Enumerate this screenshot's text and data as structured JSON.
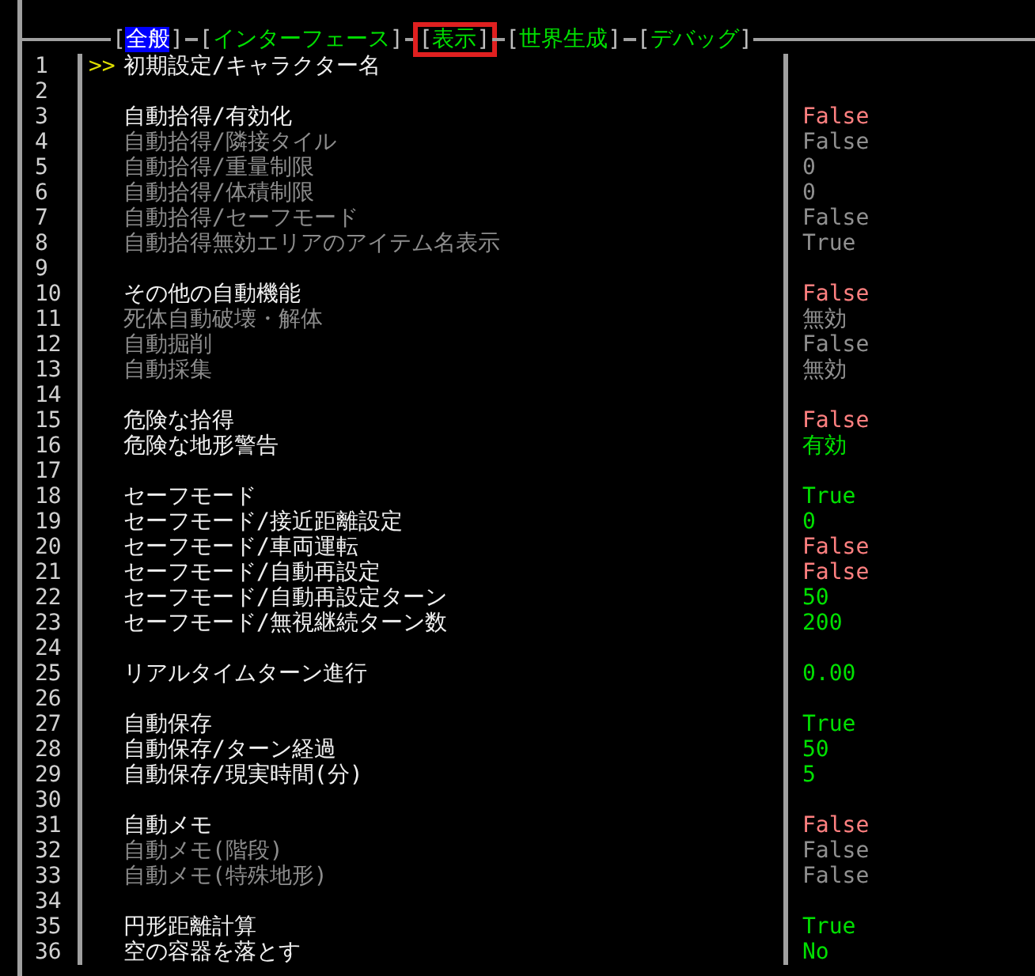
{
  "tab_bar": {
    "open": "[",
    "close": "]",
    "tabs": [
      {
        "label": "全般",
        "selected": true,
        "highlighted": false
      },
      {
        "label": "インターフェース",
        "selected": false,
        "highlighted": false
      },
      {
        "label": "表示",
        "selected": false,
        "highlighted": true
      },
      {
        "label": "世界生成",
        "selected": false,
        "highlighted": false
      },
      {
        "label": "デバッグ",
        "selected": false,
        "highlighted": false
      }
    ]
  },
  "rows": [
    {
      "number": "1",
      "marker": ">>",
      "label": "初期設定/キャラクター名",
      "disabled": false
    },
    {
      "number": "2"
    },
    {
      "number": "3",
      "label": "自動拾得/有効化",
      "disabled": false,
      "value": "False",
      "color": "#ff8080"
    },
    {
      "number": "4",
      "label": "自動拾得/隣接タイル",
      "disabled": true,
      "value": "False",
      "color": "#909090"
    },
    {
      "number": "5",
      "label": "自動拾得/重量制限",
      "disabled": true,
      "value": "0",
      "color": "#909090"
    },
    {
      "number": "6",
      "label": "自動拾得/体積制限",
      "disabled": true,
      "value": "0",
      "color": "#909090"
    },
    {
      "number": "7",
      "label": "自動拾得/セーフモード",
      "disabled": true,
      "value": "False",
      "color": "#909090"
    },
    {
      "number": "8",
      "label": "自動拾得無効エリアのアイテム名表示",
      "disabled": true,
      "value": "True",
      "color": "#909090"
    },
    {
      "number": "9"
    },
    {
      "number": "10",
      "label": "その他の自動機能",
      "disabled": false,
      "value": "False",
      "color": "#ff8080"
    },
    {
      "number": "11",
      "label": "死体自動破壊・解体",
      "disabled": true,
      "value": "無効",
      "color": "#909090"
    },
    {
      "number": "12",
      "label": "自動掘削",
      "disabled": true,
      "value": "False",
      "color": "#909090"
    },
    {
      "number": "13",
      "label": "自動採集",
      "disabled": true,
      "value": "無効",
      "color": "#909090"
    },
    {
      "number": "14"
    },
    {
      "number": "15",
      "label": "危険な拾得",
      "disabled": false,
      "value": "False",
      "color": "#ff8080"
    },
    {
      "number": "16",
      "label": "危険な地形警告",
      "disabled": false,
      "value": "有効",
      "color": "#00e000"
    },
    {
      "number": "17"
    },
    {
      "number": "18",
      "label": "セーフモード",
      "disabled": false,
      "value": "True",
      "color": "#00e000"
    },
    {
      "number": "19",
      "label": "セーフモード/接近距離設定",
      "disabled": false,
      "value": "0",
      "color": "#00e000"
    },
    {
      "number": "20",
      "label": "セーフモード/車両運転",
      "disabled": false,
      "value": "False",
      "color": "#ff8080"
    },
    {
      "number": "21",
      "label": "セーフモード/自動再設定",
      "disabled": false,
      "value": "False",
      "color": "#ff8080"
    },
    {
      "number": "22",
      "label": "セーフモード/自動再設定ターン",
      "disabled": false,
      "value": "50",
      "color": "#00e000"
    },
    {
      "number": "23",
      "label": "セーフモード/無視継続ターン数",
      "disabled": false,
      "value": "200",
      "color": "#00e000"
    },
    {
      "number": "24"
    },
    {
      "number": "25",
      "label": "リアルタイムターン進行",
      "disabled": false,
      "value": "0.00",
      "color": "#00e000"
    },
    {
      "number": "26"
    },
    {
      "number": "27",
      "label": "自動保存",
      "disabled": false,
      "value": "True",
      "color": "#00e000"
    },
    {
      "number": "28",
      "label": "自動保存/ターン経過",
      "disabled": false,
      "value": "50",
      "color": "#00e000"
    },
    {
      "number": "29",
      "label": "自動保存/現実時間(分)",
      "disabled": false,
      "value": "5",
      "color": "#00e000"
    },
    {
      "number": "30"
    },
    {
      "number": "31",
      "label": "自動メモ",
      "disabled": false,
      "value": "False",
      "color": "#ff8080"
    },
    {
      "number": "32",
      "label": "自動メモ(階段)",
      "disabled": true,
      "value": "False",
      "color": "#909090"
    },
    {
      "number": "33",
      "label": "自動メモ(特殊地形)",
      "disabled": true,
      "value": "False",
      "color": "#909090"
    },
    {
      "number": "34"
    },
    {
      "number": "35",
      "label": "円形距離計算",
      "disabled": false,
      "value": "True",
      "color": "#00e000"
    },
    {
      "number": "36",
      "label": "空の容器を落とす",
      "disabled": false,
      "value": "No",
      "color": "#00e000"
    }
  ]
}
